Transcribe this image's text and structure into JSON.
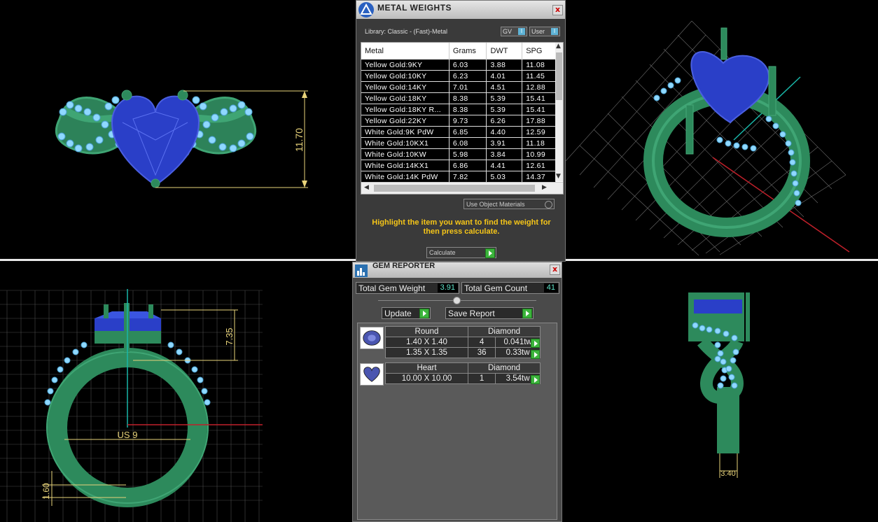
{
  "metal_weights": {
    "title": "METAL WEIGHTS",
    "close": "x",
    "library_label": "Library: Classic - (Fast)-Metal",
    "gv_label": "GV",
    "user_label": "User",
    "toggle_glyph": "I",
    "columns": [
      "Metal",
      "Grams",
      "DWT",
      "SPG"
    ],
    "rows": [
      [
        "Yellow Gold:9KY",
        "6.03",
        "3.88",
        "11.08"
      ],
      [
        "Yellow Gold:10KY",
        "6.23",
        "4.01",
        "11.45"
      ],
      [
        "Yellow Gold:14KY",
        "7.01",
        "4.51",
        "12.88"
      ],
      [
        "Yellow Gold:18KY",
        "8.38",
        "5.39",
        "15.41"
      ],
      [
        "Yellow Gold:18KY R...",
        "8.38",
        "5.39",
        "15.41"
      ],
      [
        "Yellow Gold:22KY",
        "9.73",
        "6.26",
        "17.88"
      ],
      [
        "White Gold:9K PdW",
        "6.85",
        "4.40",
        "12.59"
      ],
      [
        "White Gold:10KX1",
        "6.08",
        "3.91",
        "11.18"
      ],
      [
        "White Gold:10KW",
        "5.98",
        "3.84",
        "10.99"
      ],
      [
        "White Gold:14KX1",
        "6.86",
        "4.41",
        "12.61"
      ],
      [
        "White Gold:14K PdW",
        "7.82",
        "5.03",
        "14.37"
      ]
    ],
    "use_object_materials": "Use Object Materials",
    "hint": "Highlight the item you want to find the weight for then press calculate.",
    "calculate_label": "Calculate"
  },
  "gem_reporter": {
    "title": "GEM REPORTER",
    "close": "x",
    "total_weight_label": "Total Gem Weight",
    "total_weight_value": "3.91",
    "total_count_label": "Total Gem Count",
    "total_count_value": "41",
    "update_label": "Update",
    "save_report_label": "Save Report",
    "groups": [
      {
        "shape": "Round",
        "material": "Diamond",
        "rows": [
          {
            "size": "1.40 X 1.40",
            "count": "4",
            "weight": "0.041tw"
          },
          {
            "size": "1.35 X 1.35",
            "count": "36",
            "weight": "0.33tw"
          }
        ]
      },
      {
        "shape": "Heart",
        "material": "Diamond",
        "rows": [
          {
            "size": "10.00 X 10.00",
            "count": "1",
            "weight": "3.54tw"
          }
        ]
      }
    ]
  },
  "viewports": {
    "front_dimension": "11.70",
    "side_height_dimension": "7.35",
    "ring_size_label": "US 9",
    "band_thickness_dimension": "1.60",
    "shank_width_dimension": "3.40"
  },
  "colors": {
    "metal_green": "#2f8a5f",
    "gem_blue": "#2a3fc8",
    "accent_blue": "#8fd8ff",
    "dimension_yellow": "#e8d37a",
    "hint_yellow": "#f5c518",
    "action_green": "#3cb43c"
  }
}
